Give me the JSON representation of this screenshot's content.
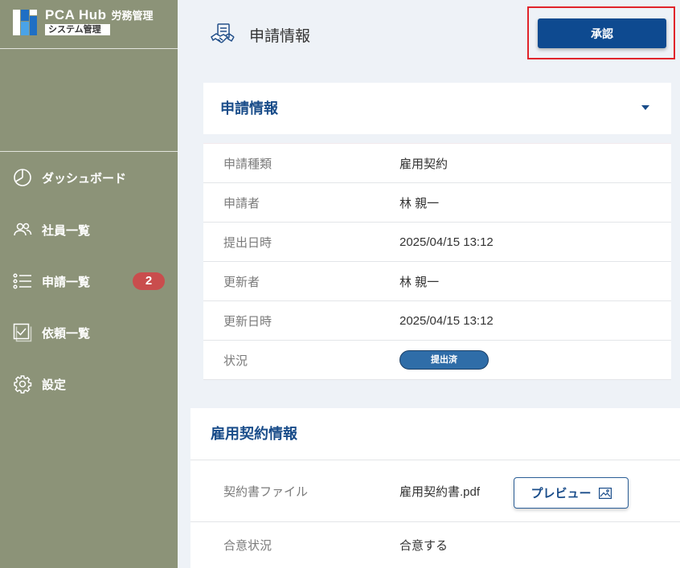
{
  "app": {
    "brand": "PCA Hub",
    "product": "労務管理",
    "subtitle": "システム管理"
  },
  "sidebar": {
    "items": [
      {
        "label": "ダッシュボード",
        "icon": "dashboard-icon"
      },
      {
        "label": "社員一覧",
        "icon": "users-icon"
      },
      {
        "label": "申請一覧",
        "icon": "list-icon",
        "badge": "2"
      },
      {
        "label": "依頼一覧",
        "icon": "checkbox-icon"
      },
      {
        "label": "設定",
        "icon": "gear-icon"
      }
    ]
  },
  "header": {
    "title": "申請情報",
    "icon": "handshake-document-icon",
    "approve_label": "承認"
  },
  "application_card": {
    "title": "申請情報",
    "rows": [
      {
        "label": "申請種類",
        "value": "雇用契約"
      },
      {
        "label": "申請者",
        "value": "林 親一"
      },
      {
        "label": "提出日時",
        "value": "2025/04/15 13:12"
      },
      {
        "label": "更新者",
        "value": "林 親一"
      },
      {
        "label": "更新日時",
        "value": "2025/04/15 13:12"
      },
      {
        "label": "状況",
        "value": "提出済"
      }
    ]
  },
  "contract_card": {
    "title": "雇用契約情報",
    "rows": [
      {
        "label": "契約書ファイル",
        "value": "雇用契約書.pdf",
        "action_label": "プレビュー",
        "action_icon": "image-icon"
      },
      {
        "label": "合意状況",
        "value": "合意する"
      }
    ]
  },
  "colors": {
    "sidebar_bg": "#8c9378",
    "main_bg": "#eef2f7",
    "accent": "#0e4a90",
    "title_blue": "#1a4d8a",
    "badge_red": "#c94d4d",
    "status_blue": "#2f6da8",
    "highlight_red": "#e0242b"
  }
}
